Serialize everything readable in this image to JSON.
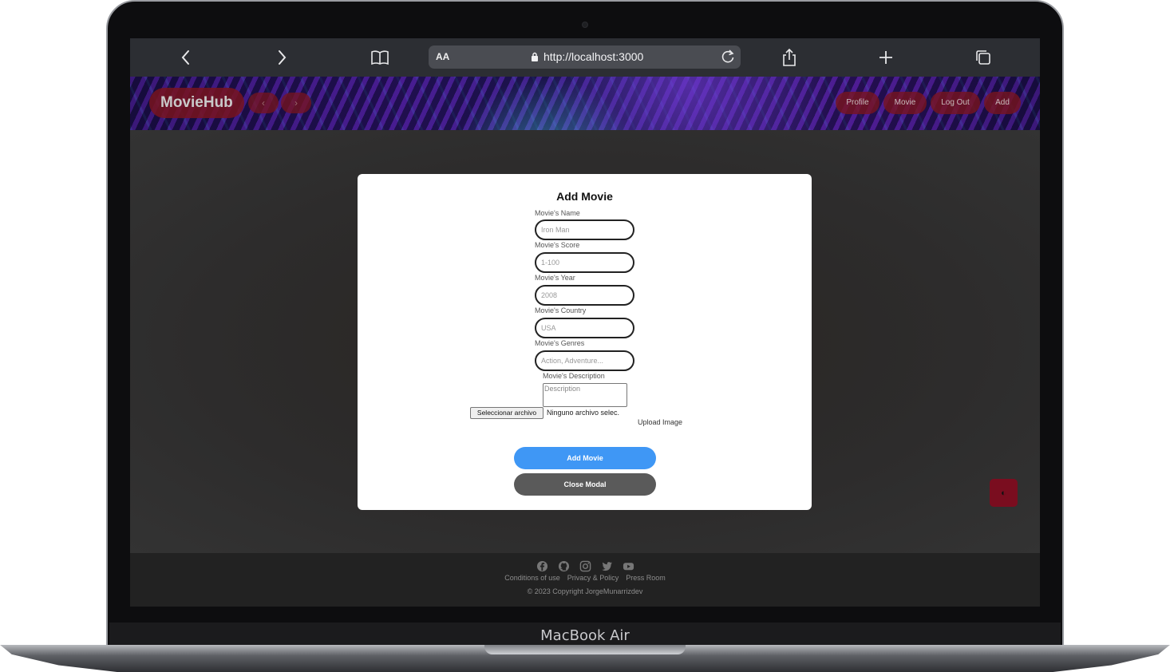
{
  "device": {
    "label": "MacBook Air"
  },
  "browser": {
    "text_size_label": "AA",
    "url": "http://localhost:3000"
  },
  "header": {
    "logo": "MovieHub",
    "back_arrow": "‹",
    "forward_arrow": "›",
    "nav": [
      {
        "label": "Profile"
      },
      {
        "label": "Movie"
      },
      {
        "label": "Log Out"
      },
      {
        "label": "Add"
      }
    ]
  },
  "modal": {
    "title": "Add Movie",
    "fields": [
      {
        "label": "Movie's Name",
        "placeholder": "Iron Man"
      },
      {
        "label": "Movie's Score",
        "placeholder": "1-100"
      },
      {
        "label": "Movie's Year",
        "placeholder": "2008"
      },
      {
        "label": "Movie's Country",
        "placeholder": "USA"
      },
      {
        "label": "Movie's Genres",
        "placeholder": "Action, Adventure..."
      }
    ],
    "description": {
      "label": "Movie's Description",
      "placeholder": "Description"
    },
    "file": {
      "button": "Seleccionar archivo",
      "status": "Ninguno archivo selec."
    },
    "upload_label": "Upload Image",
    "add_button": "Add Movie",
    "close_button": "Close Modal"
  },
  "theme_toggle": {
    "glyph": "◐",
    "color": "#7a0d1f"
  },
  "footer": {
    "social_icons": [
      "facebook-icon",
      "github-icon",
      "instagram-icon",
      "twitter-icon",
      "youtube-icon"
    ],
    "links": [
      {
        "label": "Conditions of use"
      },
      {
        "label": "Privacy & Policy"
      },
      {
        "label": "Press Room"
      }
    ],
    "copyright": "© 2023 Copyright JorgeMunarrizdev"
  },
  "colors": {
    "primary": "#3f97f5",
    "secondary": "#5a5a5a",
    "brand": "#7a0d1f"
  }
}
